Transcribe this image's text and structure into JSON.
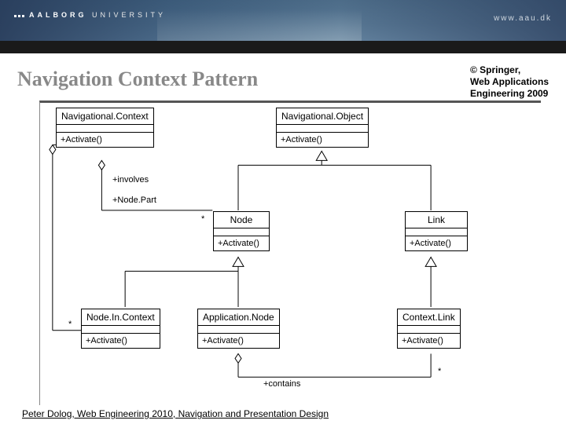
{
  "banner": {
    "university_bold": "AALBORG",
    "university_light": " UNIVERSITY",
    "url": "www.aau.dk"
  },
  "title": "Navigation Context Pattern",
  "attribution": {
    "line1": "© Springer,",
    "line2": "Web Applications",
    "line3": "Engineering 2009"
  },
  "classes": {
    "navContext": {
      "name": "Navigational.Context",
      "op": "+Activate()"
    },
    "navObject": {
      "name": "Navigational.Object",
      "op": "+Activate()"
    },
    "node": {
      "name": "Node",
      "op": "+Activate()"
    },
    "link": {
      "name": "Link",
      "op": "+Activate()"
    },
    "nodeInCtx": {
      "name": "Node.In.Context",
      "op": "+Activate()"
    },
    "appNode": {
      "name": "Application.Node",
      "op": "+Activate()"
    },
    "ctxLink": {
      "name": "Context.Link",
      "op": "+Activate()"
    }
  },
  "associations": {
    "involves": "+involves",
    "nodePart": "+Node.Part",
    "contains": "+contains",
    "star1": "*",
    "star2": "*",
    "star3": "*"
  },
  "footer": "Peter Dolog, Web Engineering 2010, Navigation and Presentation Design"
}
